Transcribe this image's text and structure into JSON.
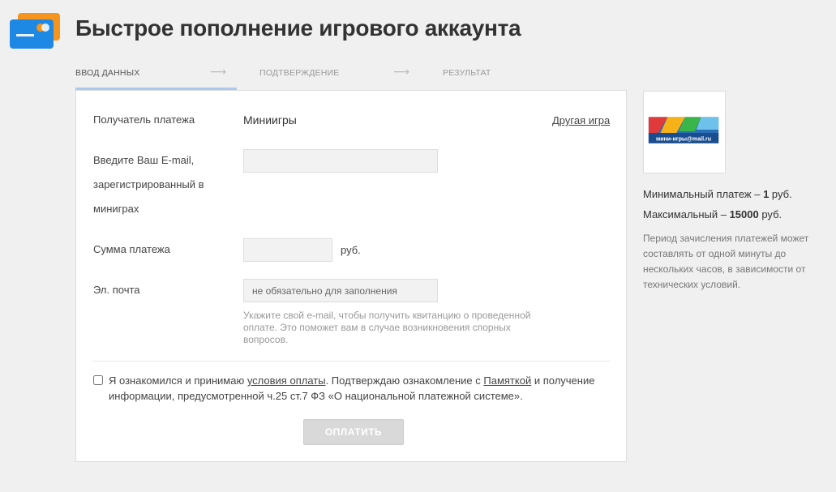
{
  "header": {
    "title": "Быстрое пополнение игрового аккаунта"
  },
  "steps": [
    {
      "label": "Ввод данных",
      "active": true
    },
    {
      "label": "Подтверждение",
      "active": false
    },
    {
      "label": "Результат",
      "active": false
    }
  ],
  "form": {
    "recipient_label": "Получатель платежа",
    "recipient_value": "Миниигры",
    "other_game_link": "Другая игра",
    "email_label_line1": "Введите Ваш E-mail,",
    "email_label_line2": "зарегистрированный в",
    "email_label_line3": "миниграх",
    "email_value": "",
    "amount_label": "Сумма платежа",
    "amount_value": "",
    "amount_unit": "руб.",
    "contact_email_label": "Эл. почта",
    "contact_email_placeholder": "не обязательно для заполнения",
    "contact_email_hint": "Укажите свой e-mail, чтобы получить квитанцию о проведенной оплате. Это поможет вам в случае возникновения спорных вопросов.",
    "agree_text_1": "Я ознакомился и принимаю ",
    "agree_link_terms": "условия оплаты",
    "agree_text_2": ". Подтверждаю ознакомление с ",
    "agree_link_memo": "Памяткой",
    "agree_text_3": " и получение информации, предусмотренной ч.25 ст.7 ФЗ «О национальной платежной системе».",
    "agree_checked": false,
    "pay_button": "ОПЛАТИТЬ"
  },
  "sidebar": {
    "game_logo_text": "мини-игры@mail.ru",
    "min_label": "Минимальный платеж – ",
    "min_value": "1",
    "min_unit": " руб.",
    "max_label": "Максимальный – ",
    "max_value": "15000",
    "max_unit": " руб.",
    "note": "Период зачисления платежей может составлять от одной минуты до нескольких часов, в зависимости от технических условий."
  },
  "icons": {
    "logo": "payment-cards-icon",
    "step_arrow": "arrow-right-icon",
    "checkbox": "checkbox-icon"
  },
  "colors": {
    "accent_orange": "#f7941d",
    "accent_blue": "#1e88e5",
    "step_underline": "#aec9ee",
    "button_disabled": "#d9d9d9"
  }
}
